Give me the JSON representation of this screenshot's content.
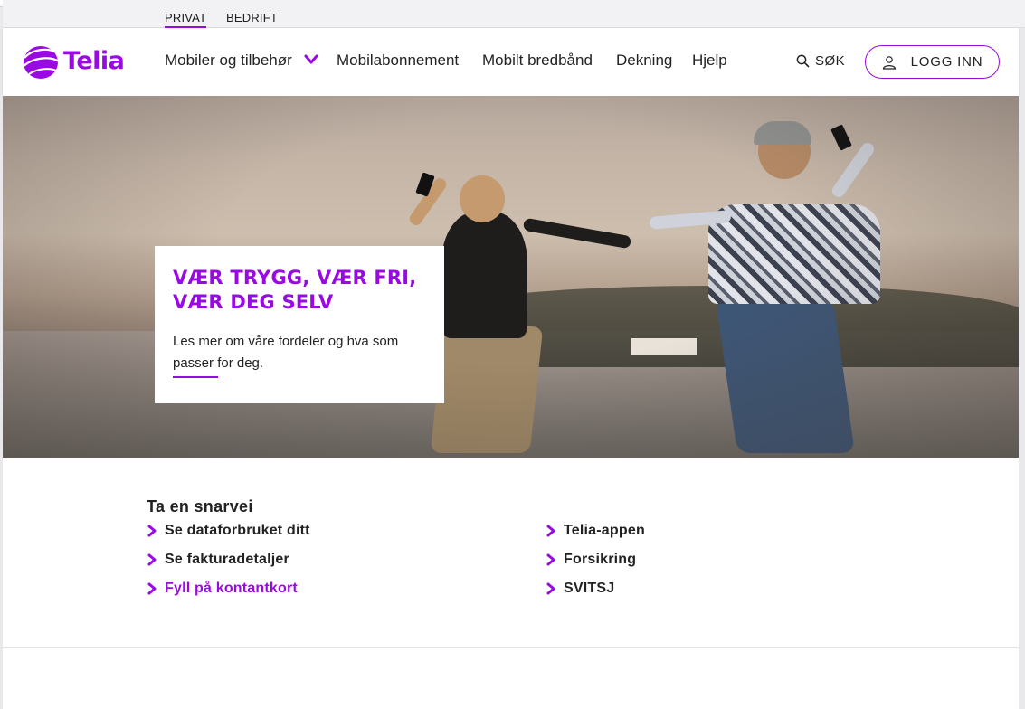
{
  "segments": {
    "private": "PRIVAT",
    "business": "BEDRIFT"
  },
  "brand": {
    "name": "Telia",
    "accent": "#990ae3"
  },
  "nav": {
    "items": [
      "Mobiler og tilbehør",
      "Mobilabonnement",
      "Mobilt bredbånd",
      "Dekning",
      "Hjelp"
    ],
    "search_label": "SØK",
    "login_label": "LOGG INN"
  },
  "hero": {
    "title": "VÆR TRYGG, VÆR FRI,\nVÆR DEG SELV",
    "text": "Les mer om våre fordeler og hva som passer for deg."
  },
  "shortcuts": {
    "title": "Ta en snarvei",
    "left": [
      "Se dataforbruket ditt",
      "Se fakturadetaljer",
      "Fyll på kontantkort"
    ],
    "right": [
      "Telia-appen",
      "Forsikring",
      "SVITSJ"
    ]
  },
  "icons": [
    "telia-logo-icon",
    "chevron-down-icon",
    "search-icon",
    "user-icon",
    "chevron-right-icon"
  ]
}
